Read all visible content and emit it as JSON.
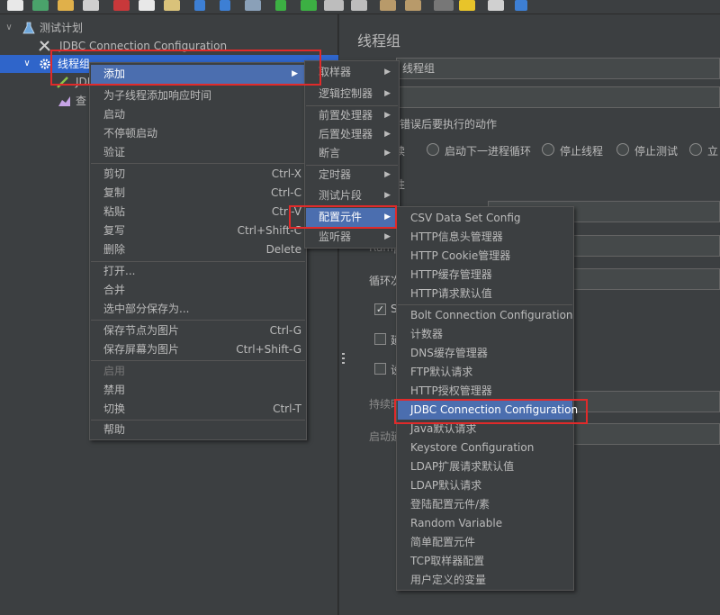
{
  "toolbar": {
    "icons": [
      "new-icon",
      "templates-icon",
      "open-icon",
      "save-icon",
      "cut-icon",
      "copy-icon",
      "paste-icon",
      "expand-icon",
      "collapse-icon",
      "toggle-icon",
      "start-icon",
      "start-no-pause-icon",
      "stop-icon",
      "shutdown-icon",
      "clear-icon",
      "clear-all-icon",
      "search-icon",
      "reset-search-icon",
      "function-helper-icon",
      "help-icon"
    ]
  },
  "tree": {
    "items": [
      {
        "label": "测试计划",
        "icon": "flask-icon"
      },
      {
        "label": "JDBC Connection Configuration",
        "icon": "wrench-icon"
      },
      {
        "label": "线程组",
        "icon": "gear-icon"
      },
      {
        "label": "JDI",
        "icon": "pen-icon"
      },
      {
        "label": "查",
        "icon": "chart-icon"
      }
    ]
  },
  "right_panel": {
    "title": "线程组",
    "name_value": "线程组",
    "error_action_label": "器错误后要执行的动作",
    "radios": [
      "续",
      "启动下一进程循环",
      "停止线程",
      "停止测试",
      "立"
    ],
    "props_label": "性",
    "ramp_label": "Ramp",
    "loop_label": "循环次",
    "checkbox_s": "S",
    "checkbox_2": "延",
    "checkbox_3": "设",
    "duration_label": "持续时",
    "startup_label": "启动延"
  },
  "context_menu": {
    "items": [
      {
        "label": "添加",
        "arrow": true,
        "highlighted": true
      },
      {
        "label": "为子线程添加响应时间"
      },
      {
        "label": "启动"
      },
      {
        "label": "不停顿启动"
      },
      {
        "label": "验证"
      },
      {
        "label": "剪切",
        "shortcut": "Ctrl-X"
      },
      {
        "label": "复制",
        "shortcut": "Ctrl-C"
      },
      {
        "label": "粘贴",
        "shortcut": "Ctrl-V"
      },
      {
        "label": "复写",
        "shortcut": "Ctrl+Shift-C"
      },
      {
        "label": "删除",
        "shortcut": "Delete"
      },
      {
        "label": "打开..."
      },
      {
        "label": "合并"
      },
      {
        "label": "选中部分保存为..."
      },
      {
        "label": "保存节点为图片",
        "shortcut": "Ctrl-G"
      },
      {
        "label": "保存屏幕为图片",
        "shortcut": "Ctrl+Shift-G"
      },
      {
        "label": "启用",
        "disabled": true
      },
      {
        "label": "禁用"
      },
      {
        "label": "切换",
        "shortcut": "Ctrl-T"
      },
      {
        "label": "帮助"
      }
    ]
  },
  "add_submenu": {
    "items": [
      {
        "label": "取样器"
      },
      {
        "label": "逻辑控制器"
      },
      {
        "label": "前置处理器"
      },
      {
        "label": "后置处理器"
      },
      {
        "label": "断言"
      },
      {
        "label": "定时器"
      },
      {
        "label": "测试片段"
      },
      {
        "label": "配置元件",
        "highlighted": true
      },
      {
        "label": "监听器"
      }
    ]
  },
  "config_submenu": {
    "items": [
      {
        "label": "CSV Data Set Config"
      },
      {
        "label": "HTTP信息头管理器"
      },
      {
        "label": "HTTP Cookie管理器"
      },
      {
        "label": "HTTP缓存管理器"
      },
      {
        "label": "HTTP请求默认值"
      },
      {
        "label": "Bolt Connection Configuration"
      },
      {
        "label": "计数器"
      },
      {
        "label": "DNS缓存管理器"
      },
      {
        "label": "FTP默认请求"
      },
      {
        "label": "HTTP授权管理器"
      },
      {
        "label": "JDBC Connection Configuration",
        "highlighted": true
      },
      {
        "label": "Java默认请求"
      },
      {
        "label": "Keystore Configuration"
      },
      {
        "label": "LDAP扩展请求默认值"
      },
      {
        "label": "LDAP默认请求"
      },
      {
        "label": "登陆配置元件/素"
      },
      {
        "label": "Random Variable"
      },
      {
        "label": "简单配置元件"
      },
      {
        "label": "TCP取样器配置"
      },
      {
        "label": "用户定义的变量"
      }
    ]
  },
  "colors": {
    "background": "#3c3f41",
    "highlight": "#4b6eaf",
    "selection": "#2f65ca",
    "annotation_red": "#e12a2a"
  }
}
